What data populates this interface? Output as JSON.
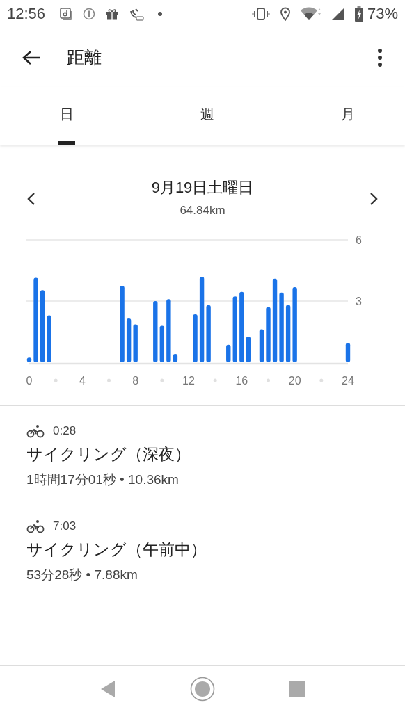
{
  "status_bar": {
    "time": "12:56",
    "battery": "73%"
  },
  "app_bar": {
    "title": "距離"
  },
  "tabs": [
    {
      "label": "日",
      "selected": true
    },
    {
      "label": "週",
      "selected": false
    },
    {
      "label": "月",
      "selected": false
    }
  ],
  "summary": {
    "date": "9月19日土曜日",
    "total": "64.84km"
  },
  "chart_data": {
    "type": "bar",
    "x": [
      0,
      0.5,
      1,
      1.5,
      7,
      7.5,
      8,
      9.5,
      10,
      10.5,
      11,
      12.5,
      13,
      13.5,
      15,
      15.5,
      16,
      16.5,
      17.5,
      18,
      18.5,
      19,
      19.5,
      20,
      24
    ],
    "series": [
      {
        "color": "#1a73e8",
        "values": [
          0.23,
          4.14,
          3.54,
          2.3,
          3.74,
          2.15,
          1.86,
          3.0,
          1.79,
          3.09,
          0.41,
          2.35,
          4.19,
          2.8,
          0.86,
          3.23,
          3.45,
          1.26,
          1.62,
          2.71,
          4.1,
          3.42,
          2.81,
          3.68,
          0.95
        ]
      }
    ],
    "xlim": [
      0,
      24
    ],
    "ylim": [
      0,
      6
    ],
    "xticks": [
      0,
      4,
      8,
      12,
      16,
      20,
      24
    ],
    "yticks": [
      3,
      6
    ]
  },
  "activities": [
    {
      "time": "0:28",
      "title": "サイクリング（深夜）",
      "details": "1時間17分01秒 • 10.36km"
    },
    {
      "time": "7:03",
      "title": "サイクリング（午前中）",
      "details": "53分28秒 • 7.88km"
    }
  ]
}
